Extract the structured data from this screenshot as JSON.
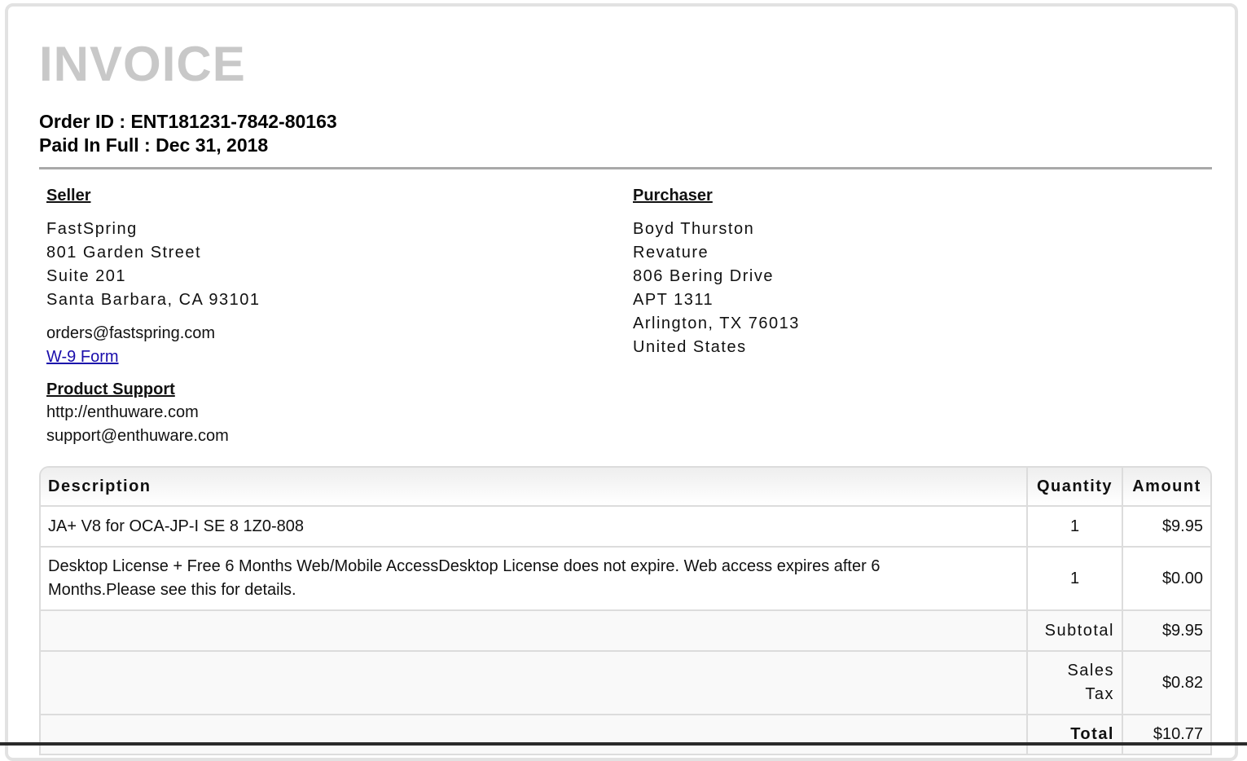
{
  "header": {
    "title": "INVOICE",
    "order_id": "Order ID : ENT181231-7842-80163",
    "paid_line": "Paid In Full : Dec 31, 2018"
  },
  "seller": {
    "heading": "Seller",
    "address": [
      "FastSpring",
      "801 Garden Street",
      "Suite 201",
      "Santa Barbara, CA 93101"
    ],
    "email": "orders@fastspring.com",
    "w9_link": "W-9 Form",
    "support_heading": "Product Support",
    "support_url": "http://enthuware.com",
    "support_email": "support@enthuware.com"
  },
  "purchaser": {
    "heading": "Purchaser",
    "address": [
      "Boyd Thurston",
      "Revature",
      "806 Bering Drive",
      "APT 1311",
      "Arlington, TX 76013",
      "United States"
    ]
  },
  "table": {
    "headers": {
      "description": "Description",
      "quantity": "Quantity",
      "amount": "Amount"
    },
    "rows": [
      {
        "description": "JA+ V8 for OCA-JP-I SE 8 1Z0-808",
        "quantity": "1",
        "amount": "$9.95"
      },
      {
        "description": "Desktop License + Free 6 Months Web/Mobile AccessDesktop License does not expire. Web access expires after 6 Months.Please see this for details.",
        "quantity": "1",
        "amount": "$0.00"
      }
    ],
    "subtotal": {
      "label": "Subtotal",
      "amount": "$9.95"
    },
    "tax": {
      "label": "Sales Tax",
      "amount": "$0.82"
    },
    "total": {
      "label": "Total",
      "amount": "$10.77"
    }
  }
}
